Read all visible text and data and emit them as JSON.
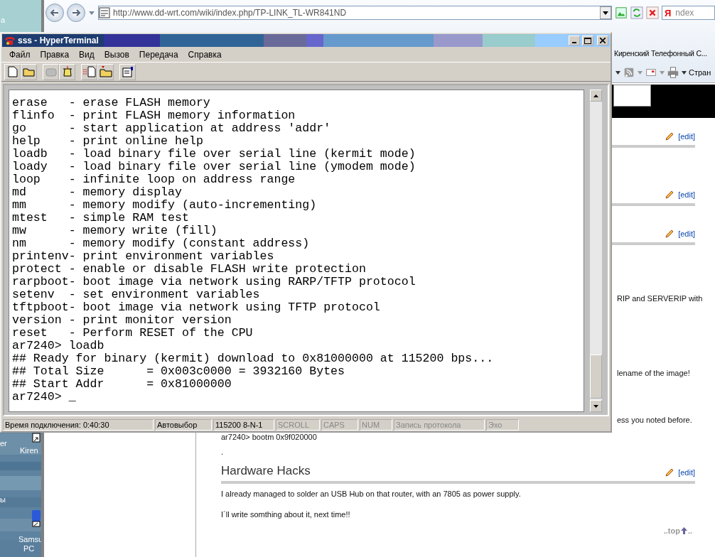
{
  "desktop": {
    "labels": [
      {
        "text": "а"
      },
      {
        "text": "er"
      },
      {
        "text": "Kiren"
      },
      {
        "text": "ы"
      },
      {
        "text": "Samsu"
      },
      {
        "text": "PC"
      }
    ]
  },
  "browser": {
    "address": "http://www.dd-wrt.com/wiki/index.php/TP-LINK_TL-WR841ND",
    "search": {
      "logo": "Я",
      "placeholder": "ndex"
    },
    "tab": "Киренский Телефонный С...",
    "command_more": "Стран",
    "page": [
      {
        "kind": "edit",
        "label": "[edit]"
      },
      {
        "kind": "edit",
        "label": "[edit]"
      },
      {
        "kind": "edit",
        "label": "[edit]"
      },
      {
        "kind": "fragment",
        "text": "RIP and SERVERIP with"
      },
      {
        "kind": "fragment",
        "text": "lename of the image!"
      },
      {
        "kind": "fragment",
        "text": "ess you noted before."
      },
      {
        "kind": "text",
        "text": "ar7240> bootm 0x9f020000"
      },
      {
        "kind": "text",
        "text": "."
      },
      {
        "kind": "heading",
        "text": "Hardware Hacks",
        "label": "[edit]"
      },
      {
        "kind": "text",
        "text": "I already managed to solder an USB Hub on that router, with an 7805 as power supply."
      },
      {
        "kind": "text",
        "text": "I´ll write somthing about it, next time!!"
      },
      {
        "kind": "top",
        "text": "..top",
        "tail": ".."
      }
    ]
  },
  "terminal": {
    "title": "sss - HyperTerminal",
    "menu": [
      "Файл",
      "Правка",
      "Вид",
      "Вызов",
      "Передача",
      "Справка"
    ],
    "toolbar": [
      {
        "kind": "new",
        "disabled": false
      },
      {
        "kind": "open",
        "disabled": false
      },
      {
        "kind": "disconnect",
        "disabled": true
      },
      {
        "kind": "call",
        "disabled": false
      },
      {
        "kind": "send",
        "disabled": false
      },
      {
        "kind": "receive",
        "disabled": false
      },
      {
        "kind": "properties",
        "disabled": false
      }
    ],
    "lines": [
      "erase   - erase FLASH memory",
      "flinfo  - print FLASH memory information",
      "go      - start application at address 'addr'",
      "help    - print online help",
      "loadb   - load binary file over serial line (kermit mode)",
      "loady   - load binary file over serial line (ymodem mode)",
      "loop    - infinite loop on address range",
      "md      - memory display",
      "mm      - memory modify (auto-incrementing)",
      "mtest   - simple RAM test",
      "mw      - memory write (fill)",
      "nm      - memory modify (constant address)",
      "printenv- print environment variables",
      "protect - enable or disable FLASH write protection",
      "rarpboot- boot image via network using RARP/TFTP protocol",
      "setenv  - set environment variables",
      "tftpboot- boot image via network using TFTP protocol",
      "version - print monitor version",
      "reset   - Perform RESET of the CPU",
      "ar7240> loadb",
      "## Ready for binary (kermit) download to 0x81000000 at 115200 bps...",
      "## Total Size      = 0x003c0000 = 3932160 Bytes",
      "## Start Addr      = 0x81000000",
      "ar7240> _"
    ],
    "status": [
      {
        "text": "Время подключения: 0:40:30",
        "active": true
      },
      {
        "text": "Автовыбор",
        "active": true
      },
      {
        "text": "115200 8-N-1",
        "active": true
      },
      {
        "text": "SCROLL",
        "active": false
      },
      {
        "text": "CAPS",
        "active": false
      },
      {
        "text": "NUM",
        "active": false
      },
      {
        "text": "Запись протокола",
        "active": false
      },
      {
        "text": "Эхо",
        "active": false
      }
    ]
  }
}
